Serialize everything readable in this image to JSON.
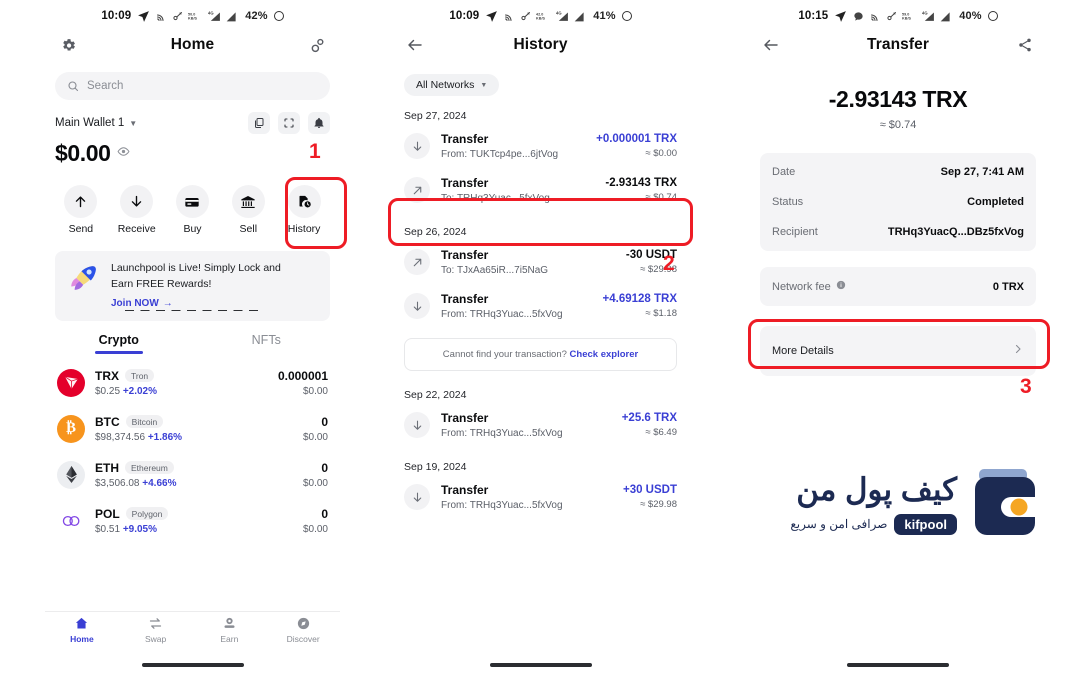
{
  "home": {
    "status": {
      "time": "10:09",
      "battery": "42%"
    },
    "nav": {
      "title": "Home",
      "left_icon": "gear-icon",
      "right_icon": "link-icon"
    },
    "search": {
      "placeholder": "Search"
    },
    "wallet": {
      "name": "Main Wallet 1",
      "balance": "$0.00"
    },
    "quick_actions": [
      {
        "label": "Send",
        "icon": "arrow-up-icon"
      },
      {
        "label": "Receive",
        "icon": "arrow-down-icon"
      },
      {
        "label": "Buy",
        "icon": "credit-card-icon"
      },
      {
        "label": "Sell",
        "icon": "bank-icon"
      },
      {
        "label": "History",
        "icon": "history-icon"
      }
    ],
    "promo": {
      "line1": "Launchpool is Live! Simply Lock and",
      "line2": "Earn FREE Rewards!",
      "cta": "Join NOW",
      "dots": "— — — — — — — — —"
    },
    "tabs": [
      {
        "label": "Crypto",
        "active": true
      },
      {
        "label": "NFTs",
        "active": false
      }
    ],
    "tokens": [
      {
        "symbol": "TRX",
        "chain": "Tron",
        "price": "$0.25",
        "change": "+2.02%",
        "amount": "0.000001",
        "value": "$0.00",
        "color": "#e4002b"
      },
      {
        "symbol": "BTC",
        "chain": "Bitcoin",
        "price": "$98,374.56",
        "change": "+1.86%",
        "amount": "0",
        "value": "$0.00",
        "color": "#f7941d"
      },
      {
        "symbol": "ETH",
        "chain": "Ethereum",
        "price": "$3,506.08",
        "change": "+4.66%",
        "amount": "0",
        "value": "$0.00",
        "color": "#eceef1"
      },
      {
        "symbol": "POL",
        "chain": "Polygon",
        "price": "$0.51",
        "change": "+9.05%",
        "amount": "0",
        "value": "$0.00",
        "color": "#ffffff"
      }
    ],
    "bottom_nav": [
      {
        "label": "Home",
        "icon": "home-icon",
        "active": true
      },
      {
        "label": "Swap",
        "icon": "swap-icon",
        "active": false
      },
      {
        "label": "Earn",
        "icon": "earn-icon",
        "active": false
      },
      {
        "label": "Discover",
        "icon": "compass-icon",
        "active": false
      }
    ]
  },
  "history": {
    "status": {
      "time": "10:09",
      "battery": "41%"
    },
    "nav": {
      "title": "History",
      "left_icon": "back-arrow-icon"
    },
    "filter_chip": "All Networks",
    "groups": [
      {
        "date": "Sep 27, 2024",
        "items": [
          {
            "title": "Transfer",
            "sub": "From: TUKTcp4pe...6jtVog",
            "amount": "+0.000001 TRX",
            "value": "≈ $0.00",
            "direction": "in",
            "positive": true,
            "highlighted": false
          },
          {
            "title": "Transfer",
            "sub": "To: TRHq3Yuac...5fxVog",
            "amount": "-2.93143 TRX",
            "value": "≈ $0.74",
            "direction": "out",
            "positive": false,
            "highlighted": true
          }
        ]
      },
      {
        "date": "Sep 26, 2024",
        "items": [
          {
            "title": "Transfer",
            "sub": "To: TJxAa65iR...7i5NaG",
            "amount": "-30 USDT",
            "value": "≈ $29.98",
            "direction": "out",
            "positive": false,
            "highlighted": false
          },
          {
            "title": "Transfer",
            "sub": "From: TRHq3Yuac...5fxVog",
            "amount": "+4.69128 TRX",
            "value": "≈ $1.18",
            "direction": "in",
            "positive": true,
            "highlighted": false
          }
        ]
      },
      {
        "date": "Sep 22, 2024",
        "items": [
          {
            "title": "Transfer",
            "sub": "From: TRHq3Yuac...5fxVog",
            "amount": "+25.6 TRX",
            "value": "≈ $6.49",
            "direction": "in",
            "positive": true,
            "highlighted": false
          }
        ]
      },
      {
        "date": "Sep 19, 2024",
        "items": [
          {
            "title": "Transfer",
            "sub": "From: TRHq3Yuac...5fxVog",
            "amount": "+30 USDT",
            "value": "≈ $29.98",
            "direction": "in",
            "positive": true,
            "highlighted": false
          }
        ]
      }
    ],
    "explorer": {
      "question": "Cannot find your transaction?",
      "link": "Check explorer"
    }
  },
  "detail": {
    "status": {
      "time": "10:15",
      "battery": "40%"
    },
    "nav": {
      "title": "Transfer",
      "left_icon": "back-arrow-icon",
      "right_icon": "share-icon"
    },
    "amount": "-2.93143 TRX",
    "amount_usd": "≈ $0.74",
    "rows": [
      {
        "key": "Date",
        "value": "Sep 27, 7:41 AM"
      },
      {
        "key": "Status",
        "value": "Completed"
      },
      {
        "key": "Recipient",
        "value": "TRHq3YuacQ...DBz5fxVog"
      }
    ],
    "fee": {
      "key": "Network fee",
      "value": "0 TRX",
      "info_icon": "info-icon"
    },
    "more_details": {
      "label": "More Details",
      "chevron": "chevron-right-icon"
    }
  },
  "annotations": {
    "steps": [
      "1",
      "2",
      "3"
    ],
    "highlight_color": "#ee1c25"
  },
  "brand": {
    "name_fa": "کیف پول من",
    "tagline_fa": "صرافی امن و سریع",
    "pill": "kifpool"
  }
}
